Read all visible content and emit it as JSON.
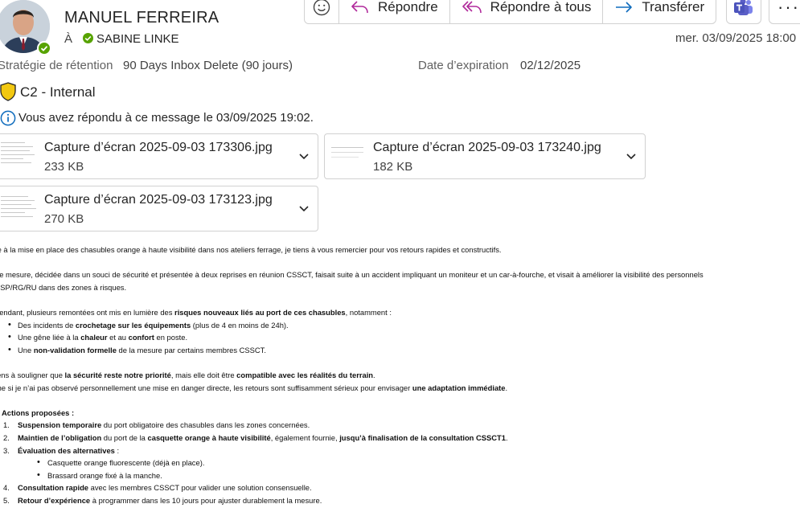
{
  "header": {
    "sender": "MANUEL FERREIRA",
    "to_label": "À",
    "recipient": "SABINE LINKE",
    "date": "mer. 03/09/2025 18:00"
  },
  "toolbar": {
    "reply": "Répondre",
    "reply_all": "Répondre à tous",
    "forward": "Transférer",
    "more": "···"
  },
  "retention": {
    "label": "Stratégie de rétention",
    "value": "90 Days Inbox Delete (90 jours)",
    "expiry_label": "Date d’expiration",
    "expiry_value": "02/12/2025"
  },
  "classification": "C2 - Internal",
  "replied_notice": "Vous avez répondu à ce message le 03/09/2025 19:02.",
  "attachments": [
    {
      "name": "Capture d’écran 2025-09-03 173306.jpg",
      "size": "233 KB"
    },
    {
      "name": "Capture d’écran 2025-09-03 173240.jpg",
      "size": "182 KB"
    },
    {
      "name": "Capture d’écran 2025-09-03 173123.jpg",
      "size": "270 KB"
    }
  ],
  "body": {
    "p1": "te à la mise en place des chasubles orange à haute visibilité dans nos ateliers ferrage, je tiens à vous remercier pour vos retours rapides et constructifs.",
    "p2a": "tte mesure, décidée dans un souci de sécurité et présentée à deux reprises en réunion CSSCT, faisait suite à un accident impliquant un moniteur et un car-à-fourche, et visait à améliorer la visibilité des personnels",
    "p2b": "PSP/RG/RU dans des zones à risques.",
    "p3_start": "pendant, plusieurs remontées ont mis en lumière des ",
    "p3_bold": "risques nouveaux liés au port de ces chasubles",
    "p3_end": ", notamment :",
    "li1_a": "Des incidents de ",
    "li1_b": "crochetage sur les équipements",
    "li1_c": " (plus de 4 en moins de 24h).",
    "li2_a": "Une gêne liée à la ",
    "li2_b": "chaleur",
    "li2_c": " et au ",
    "li2_d": "confort",
    "li2_e": " en poste.",
    "li3_a": "Une ",
    "li3_b": "non-validation formelle",
    "li3_c": " de la mesure par certains membres CSSCT.",
    "p4_a": "iens à souligner que ",
    "p4_b": "la sécurité reste notre priorité",
    "p4_c": ", mais elle doit être ",
    "p4_d": "compatible avec les réalités du terrain",
    "p4_e": ".",
    "p5_a": "me si je n’ai pas observé personnellement une mise en danger directe, les retours sont suffisamment sérieux pour envisager ",
    "p5_b": "une adaptation immédiate",
    "p5_c": ".",
    "actions_title": "Actions proposées :",
    "a1_num": "1.",
    "a1_b": "Suspension temporaire",
    "a1_c": " du port obligatoire des chasubles dans les zones concernées.",
    "a2_num": "2.",
    "a2_b": "Maintien de l’obligation",
    "a2_c": " du port de la ",
    "a2_d": "casquette orange à haute visibilité",
    "a2_e": ", également fournie, ",
    "a2_f": "jusqu’à finalisation de la consultation CSSCT1",
    "a2_g": ".",
    "a3_num": "3.",
    "a3_b": "Évaluation des alternatives",
    "a3_c": " :",
    "a3_s1": "Casquette orange fluorescente (déjà en place).",
    "a3_s2": "Brassard orange fixé à la manche.",
    "a4_num": "4.",
    "a4_b": "Consultation rapide",
    "a4_c": " avec les membres CSSCT pour valider une solution consensuelle.",
    "a5_num": "5.",
    "a5_b": "Retour d’expérience",
    "a5_c": " à programmer dans les 10 jours pour ajuster durablement la mesure."
  },
  "colors": {
    "presence": "#57a300",
    "accent": "#0f6cbd",
    "shield": "#f2c811",
    "teams": "#5b5fc7"
  }
}
